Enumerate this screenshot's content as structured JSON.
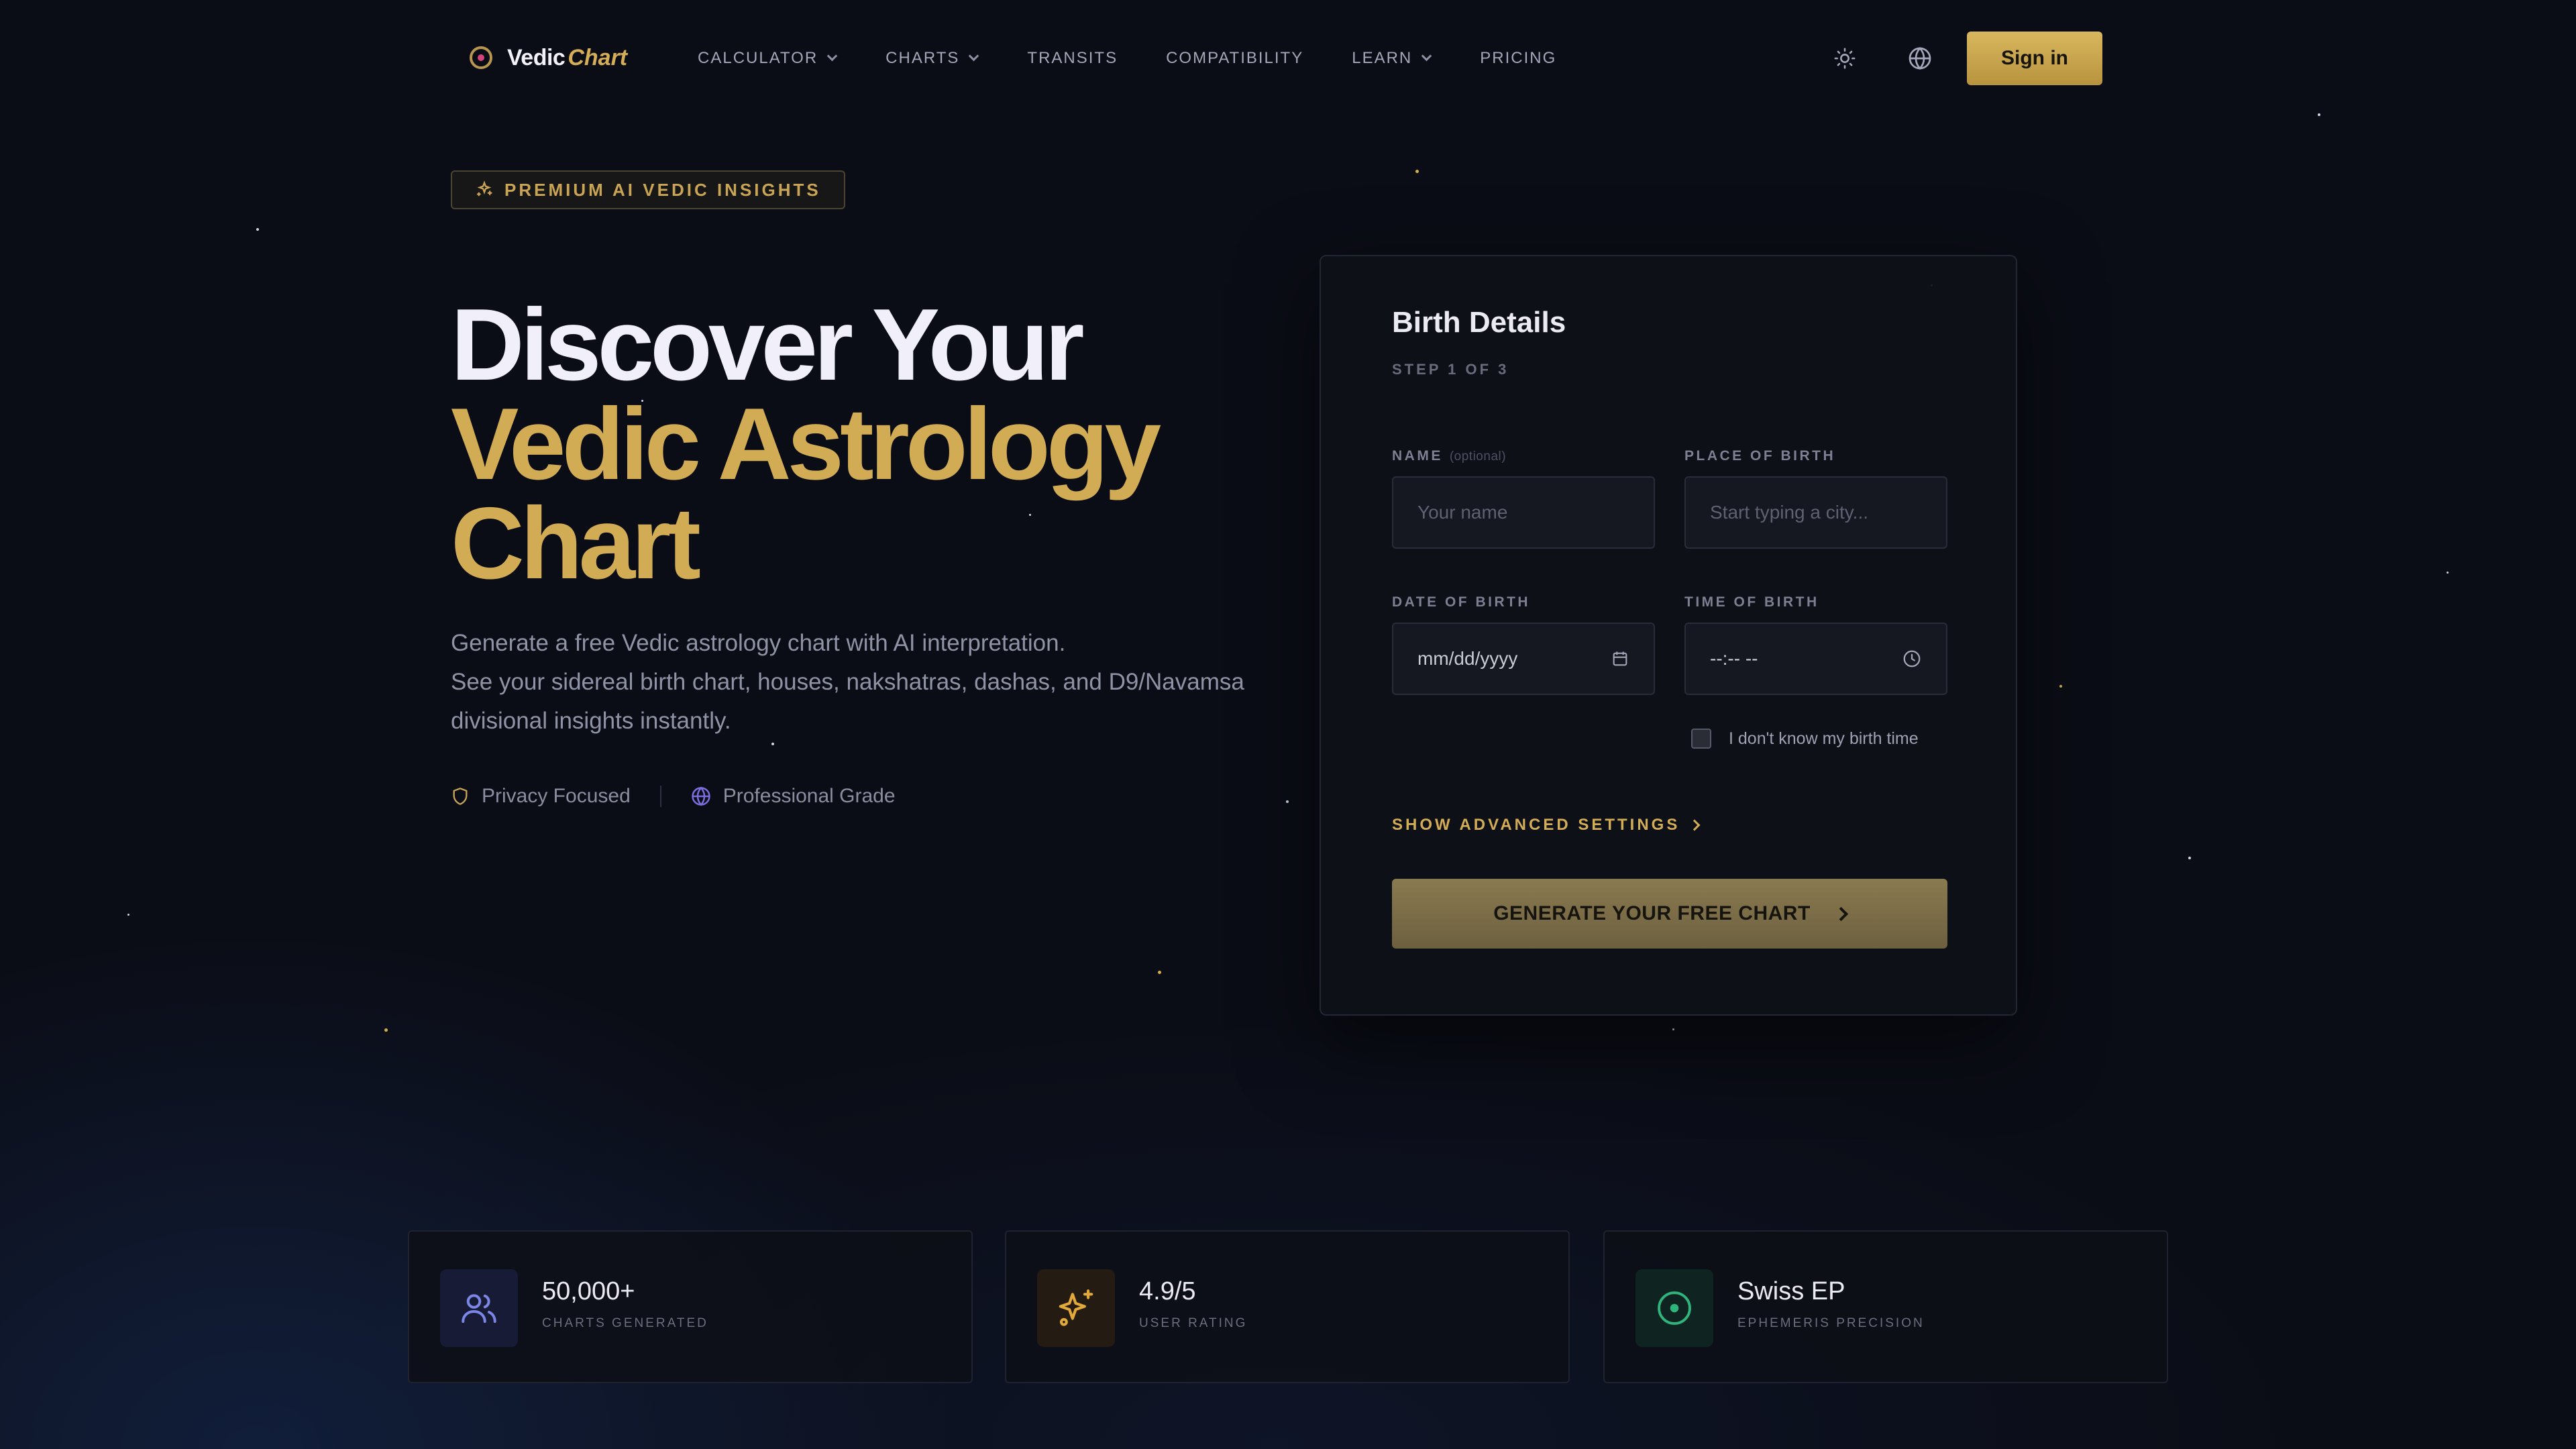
{
  "nav": {
    "logo_text": "Vedic",
    "logo_accent": "Chart",
    "links": [
      {
        "label": "CALCULATOR",
        "dropdown": true
      },
      {
        "label": "CHARTS",
        "dropdown": true
      },
      {
        "label": "TRANSITS",
        "dropdown": false
      },
      {
        "label": "COMPATIBILITY",
        "dropdown": false
      },
      {
        "label": "LEARN",
        "dropdown": true
      },
      {
        "label": "PRICING",
        "dropdown": false
      }
    ],
    "theme_icon": "sun-icon",
    "language_icon": "globe-icon",
    "sign_in_label": "Sign in"
  },
  "hero": {
    "badge": "PREMIUM AI VEDIC INSIGHTS",
    "title_line1": "Discover Your",
    "title_line2": "Vedic Astrology",
    "title_line3": "Chart",
    "subtitle_line1": "Generate a free Vedic astrology chart with AI interpretation.",
    "subtitle_line2": "See your sidereal birth chart, houses, nakshatras, dashas, and D9/Navamsa",
    "subtitle_line3": "divisional insights instantly.",
    "trust": [
      {
        "label": "Privacy Focused",
        "icon": "shield-icon"
      },
      {
        "label": "Professional Grade",
        "icon": "globe-icon"
      }
    ]
  },
  "form": {
    "title": "Birth Details",
    "step": "STEP 1 OF 3",
    "name_label": "NAME",
    "name_optional": "(optional)",
    "name_placeholder": "Your name",
    "place_label": "PLACE OF BIRTH",
    "place_placeholder": "Start typing a city...",
    "date_label": "DATE OF BIRTH",
    "date_value": "mm/dd/yyyy",
    "time_label": "TIME OF BIRTH",
    "time_value": "--:-- --",
    "unknown_time_label": "I don't know my birth time",
    "unknown_time_checked": false,
    "advanced_label": "SHOW ADVANCED SETTINGS",
    "submit_label": "GENERATE YOUR FREE CHART"
  },
  "stats": [
    {
      "value": "50,000+",
      "label": "CHARTS GENERATED",
      "icon": "users-icon",
      "color": "#7b86e6"
    },
    {
      "value": "4.9/5",
      "label": "USER RATING",
      "icon": "sparkles-icon",
      "color": "#e2a93a"
    },
    {
      "value": "Swiss EP",
      "label": "EPHEMERIS PRECISION",
      "icon": "target-icon",
      "color": "#2fb47c"
    }
  ],
  "colors": {
    "background": "#0b0d16",
    "gold_accent": "#d2ac54",
    "card_bg": "#0e1018",
    "muted_text": "#8f93a6"
  }
}
